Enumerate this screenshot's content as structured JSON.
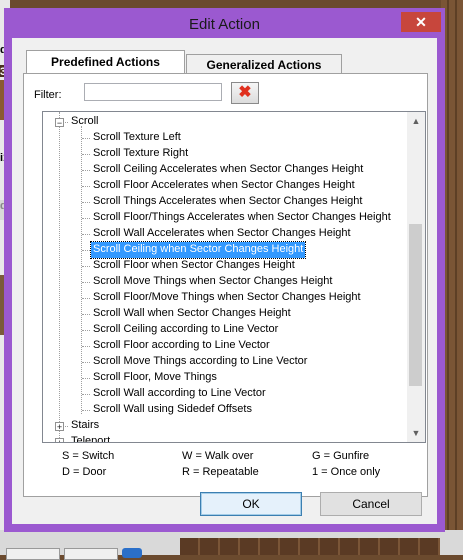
{
  "background": {
    "left_texts": [
      "d",
      "3",
      "i1",
      "d"
    ]
  },
  "dialog": {
    "title": "Edit Action",
    "close_glyph": "✕",
    "tabs": [
      {
        "label": "Predefined Actions",
        "active": true
      },
      {
        "label": "Generalized Actions",
        "active": false
      }
    ],
    "filter": {
      "label": "Filter:",
      "value": "",
      "placeholder": ""
    },
    "clear_icon": "red-x-icon",
    "tree": {
      "scroll": {
        "label": "Scroll",
        "expanded": true,
        "items": [
          "Scroll Texture Left",
          "Scroll Texture Right",
          "Scroll Ceiling Accelerates when Sector Changes Height",
          "Scroll Floor Accelerates when Sector Changes Height",
          "Scroll Things Accelerates when Sector Changes Height",
          "Scroll Floor/Things Accelerates when Sector Changes Height",
          "Scroll Wall Accelerates when Sector Changes Height",
          "Scroll Ceiling when Sector Changes Height",
          "Scroll Floor when Sector Changes Height",
          "Scroll Move Things when Sector Changes Height",
          "Scroll Floor/Move Things when Sector Changes Height",
          "Scroll Wall when Sector Changes Height",
          "Scroll Ceiling according to Line Vector",
          "Scroll Floor according to Line Vector",
          "Scroll Move Things according to Line Vector",
          "Scroll Floor, Move Things",
          "Scroll Wall according to Line Vector",
          "Scroll Wall using Sidedef Offsets"
        ],
        "selected_index": 7
      },
      "collapsed": [
        {
          "label": "Stairs"
        },
        {
          "label": "Teleport"
        }
      ],
      "expander_open": "−",
      "expander_closed": "+"
    },
    "legend": {
      "row1": [
        "S = Switch",
        "W = Walk over",
        "G = Gunfire"
      ],
      "row2": [
        "D = Door",
        "R = Repeatable",
        "1 = Once only"
      ]
    },
    "buttons": {
      "ok": "OK",
      "cancel": "Cancel"
    },
    "scroll_up": "▲",
    "scroll_down": "▼"
  },
  "colors": {
    "window_frame": "#9b59d0",
    "close_button": "#c7463c",
    "selection": "#3399ff"
  }
}
